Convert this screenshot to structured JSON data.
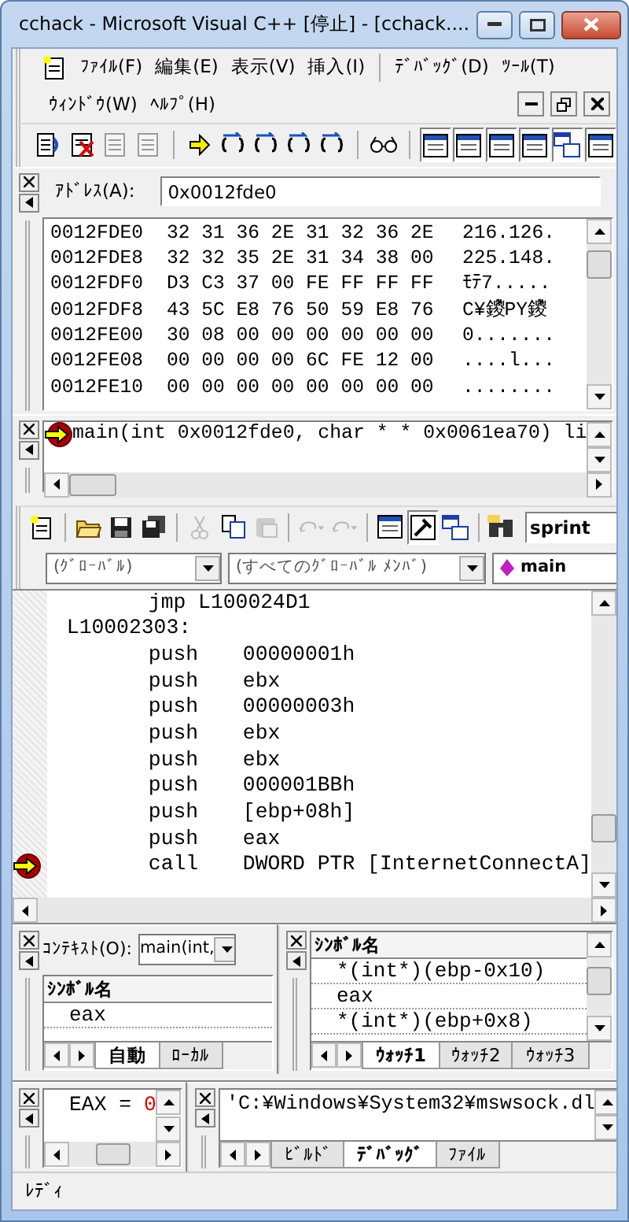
{
  "window": {
    "title": "cchack - Microsoft Visual C++ [停止] - [cchack...."
  },
  "menu_rows": [
    [
      "ﾌｧｲﾙ(F)",
      "編集(E)",
      "表示(V)",
      "挿入(I)",
      "ﾃﾞﾊﾞｯｸﾞ(D)",
      "ﾂｰﾙ(T)"
    ],
    [
      "ｳｨﾝﾄﾞｳ(W)",
      "ﾍﾙﾌﾟ(H)"
    ]
  ],
  "debug_toolbar": [
    {
      "disabled": false,
      "pressed": false
    },
    {
      "disabled": false,
      "pressed": false
    },
    {
      "disabled": true,
      "pressed": false
    },
    {
      "disabled": true,
      "pressed": false
    },
    {
      "disabled": false,
      "pressed": false
    },
    {
      "disabled": false,
      "pressed": false
    },
    {
      "disabled": false,
      "pressed": false
    },
    {
      "disabled": false,
      "pressed": false
    },
    {
      "disabled": false,
      "pressed": false
    },
    {
      "disabled": false,
      "pressed": false
    },
    {
      "disabled": false,
      "pressed": true
    },
    {
      "disabled": false,
      "pressed": true
    },
    {
      "disabled": false,
      "pressed": true
    },
    {
      "disabled": false,
      "pressed": true
    },
    {
      "disabled": false,
      "pressed": true
    },
    {
      "disabled": false,
      "pressed": true
    }
  ],
  "memory": {
    "address_label": "ｱﾄﾞﾚｽ(A):",
    "address": "0x0012fde0",
    "rows": [
      {
        "address": "0012FDE0",
        "bytes": "32 31 36 2E 31 32 36 2E",
        "ascii": "216.126."
      },
      {
        "address": "0012FDE8",
        "bytes": "32 32 35 2E 31 34 38 00",
        "ascii": "225.148."
      },
      {
        "address": "0012FDF0",
        "bytes": "D3 C3 37 00 FE FF FF FF",
        "ascii": "ﾓﾃ7....."
      },
      {
        "address": "0012FDF8",
        "bytes": "43 5C E8 76 50 59 E8 76",
        "ascii": "C¥鑁PY鑁"
      },
      {
        "address": "0012FE00",
        "bytes": "30 08 00 00 00 00 00 00",
        "ascii": "0......."
      },
      {
        "address": "0012FE08",
        "bytes": "00 00 00 00 6C FE 12 00",
        "ascii": "....l..."
      },
      {
        "address": "0012FE10",
        "bytes": "00 00 00 00 00 00 00 00",
        "ascii": "........"
      }
    ]
  },
  "call_stack": [
    {
      "text": "main(int 0x0012fde0, char * * 0x0061ea70) li",
      "current": true
    }
  ],
  "standard_toolbar": {
    "buttons": [
      {
        "disabled": false,
        "pressed": false
      },
      {
        "disabled": false,
        "pressed": false
      },
      {
        "disabled": false,
        "pressed": false
      },
      {
        "disabled": false,
        "pressed": false
      },
      {
        "disabled": true,
        "pressed": false
      },
      {
        "disabled": false,
        "pressed": false
      },
      {
        "disabled": true,
        "pressed": false
      },
      {
        "disabled": true,
        "pressed": false
      },
      {
        "disabled": true,
        "pressed": false
      },
      {
        "disabled": false,
        "pressed": false
      },
      {
        "disabled": false,
        "pressed": true
      },
      {
        "disabled": false,
        "pressed": false
      },
      {
        "disabled": false,
        "pressed": false
      }
    ],
    "find_value": "sprint"
  },
  "wizard_bar": {
    "scope": "(ｸﾞﾛｰﾊﾞﾙ)",
    "members": "(すべてのｸﾞﾛｰﾊﾞﾙ ﾒﾝﾊﾞ)",
    "function": "main"
  },
  "disassembly": [
    {
      "kind": "jump",
      "text": "jmp L100024D1",
      "current": false
    },
    {
      "kind": "label",
      "text": "L10002303:",
      "current": false
    },
    {
      "kind": "instruction",
      "op": "push",
      "operand": "00000001h",
      "current": false
    },
    {
      "kind": "instruction",
      "op": "push",
      "operand": "ebx",
      "current": false
    },
    {
      "kind": "instruction",
      "op": "push",
      "operand": "00000003h",
      "current": false
    },
    {
      "kind": "instruction",
      "op": "push",
      "operand": "ebx",
      "current": false
    },
    {
      "kind": "instruction",
      "op": "push",
      "operand": "ebx",
      "current": false
    },
    {
      "kind": "instruction",
      "op": "push",
      "operand": "000001BBh",
      "current": false
    },
    {
      "kind": "instruction",
      "op": "push",
      "operand": "[ebp+08h]",
      "current": false
    },
    {
      "kind": "instruction",
      "op": "push",
      "operand": "eax",
      "current": false
    },
    {
      "kind": "instruction",
      "op": "call",
      "operand": "DWORD PTR [InternetConnectA]",
      "current": true
    }
  ],
  "variables": {
    "context_label": "ｺﾝﾃｷｽﾄ(O):",
    "context": "main(int,",
    "column": "ｼﾝﾎﾞﾙ名",
    "rows": [
      "eax"
    ],
    "tabs": [
      {
        "label": "自動",
        "selected": true
      },
      {
        "label": "ﾛｰｶﾙ",
        "selected": false
      }
    ]
  },
  "watch": {
    "column": "ｼﾝﾎﾞﾙ名",
    "rows": [
      "*(int*)(ebp-0x10)",
      "eax",
      "*(int*)(ebp+0x8)"
    ],
    "tabs": [
      {
        "label": "ｳｫｯﾁ1",
        "selected": true
      },
      {
        "label": "ｳｫｯﾁ2",
        "selected": false
      },
      {
        "label": "ｳｫｯﾁ3",
        "selected": false
      }
    ]
  },
  "registers": [
    {
      "label": "EAX =",
      "value": "0",
      "changed": true
    }
  ],
  "output": {
    "text": "'C:¥Windows¥System32¥mswsock.dl",
    "tabs": [
      {
        "label": "ﾋﾞﾙﾄﾞ",
        "selected": false
      },
      {
        "label": "ﾃﾞﾊﾞｯｸﾞ",
        "selected": true
      },
      {
        "label": "ﾌｧｲﾙ",
        "selected": false
      }
    ]
  },
  "status_bar": "ﾚﾃﾞｨ"
}
